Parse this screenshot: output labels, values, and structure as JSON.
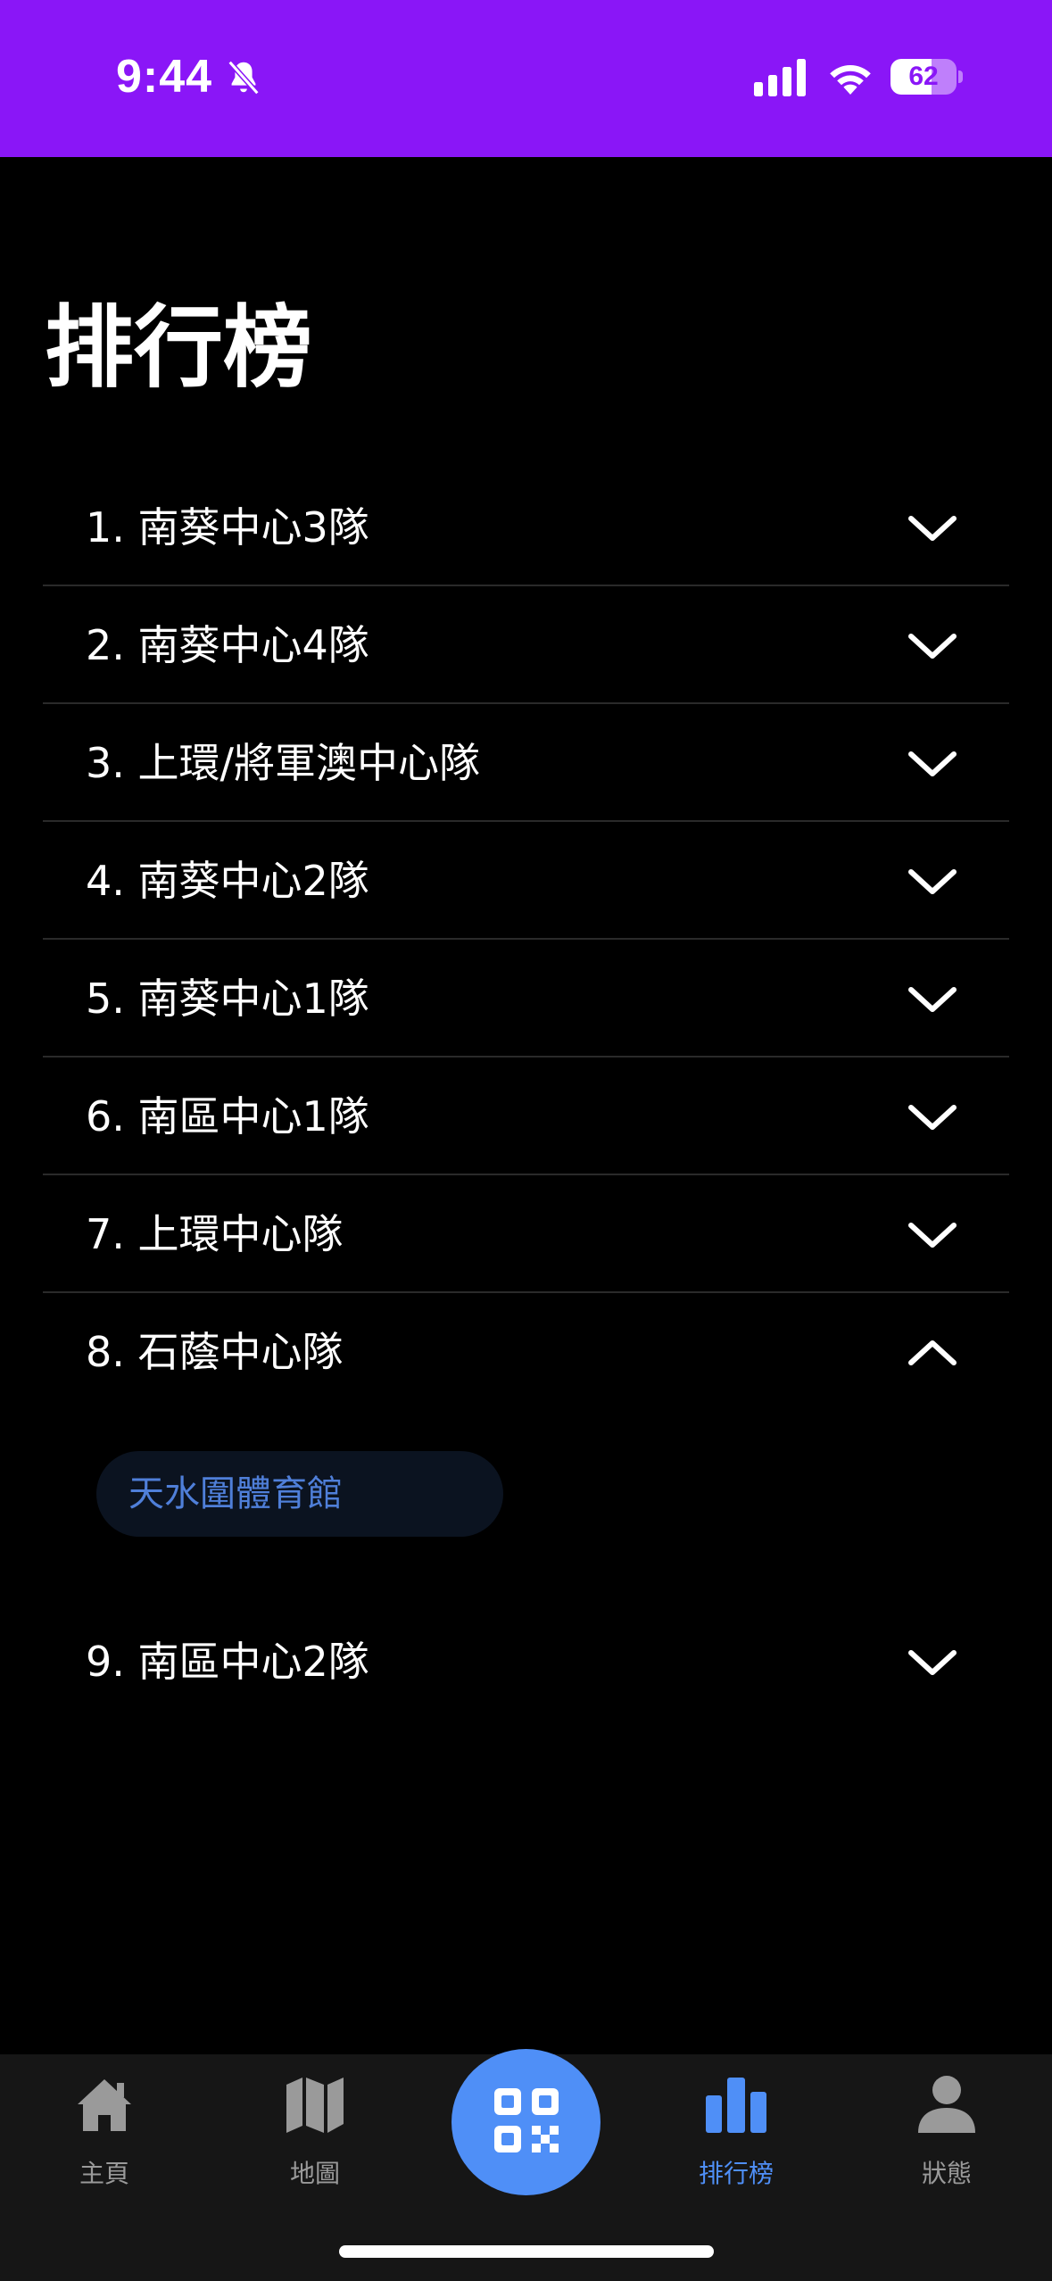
{
  "status_bar": {
    "time": "9:44",
    "battery_level": "62",
    "battery_fraction": 0.62,
    "background_color": "#8A16F7",
    "icons": [
      "bell-slash-icon",
      "cellular-signal-icon",
      "wifi-icon",
      "battery-icon"
    ]
  },
  "page": {
    "title": "排行榜"
  },
  "leaderboard": {
    "items": [
      {
        "label": "1. 南葵中心3隊",
        "expanded": false,
        "icon": "chevron-down-icon"
      },
      {
        "label": "2. 南葵中心4隊",
        "expanded": false,
        "icon": "chevron-down-icon"
      },
      {
        "label": "3. 上環/將軍澳中心隊",
        "expanded": false,
        "icon": "chevron-down-icon"
      },
      {
        "label": "4. 南葵中心2隊",
        "expanded": false,
        "icon": "chevron-down-icon"
      },
      {
        "label": "5. 南葵中心1隊",
        "expanded": false,
        "icon": "chevron-down-icon"
      },
      {
        "label": "6. 南區中心1隊",
        "expanded": false,
        "icon": "chevron-down-icon"
      },
      {
        "label": "7. 上環中心隊",
        "expanded": false,
        "icon": "chevron-down-icon"
      },
      {
        "label": "8. 石蔭中心隊",
        "expanded": true,
        "icon": "chevron-up-icon",
        "venues": [
          "天水圍體育館"
        ]
      },
      {
        "label": "9. 南區中心2隊",
        "expanded": false,
        "icon": "chevron-down-icon"
      }
    ]
  },
  "tab_bar": {
    "tabs": [
      {
        "label": "主頁",
        "icon": "home-icon",
        "active": false
      },
      {
        "label": "地圖",
        "icon": "map-icon",
        "active": false
      },
      {
        "label": "",
        "icon": "qr-code-icon",
        "active": false
      },
      {
        "label": "排行榜",
        "icon": "bar-chart-icon",
        "active": true
      },
      {
        "label": "狀態",
        "icon": "person-icon",
        "active": false
      }
    ],
    "active_color": "#4F8FF7",
    "inactive_color": "#9a9a9a"
  }
}
